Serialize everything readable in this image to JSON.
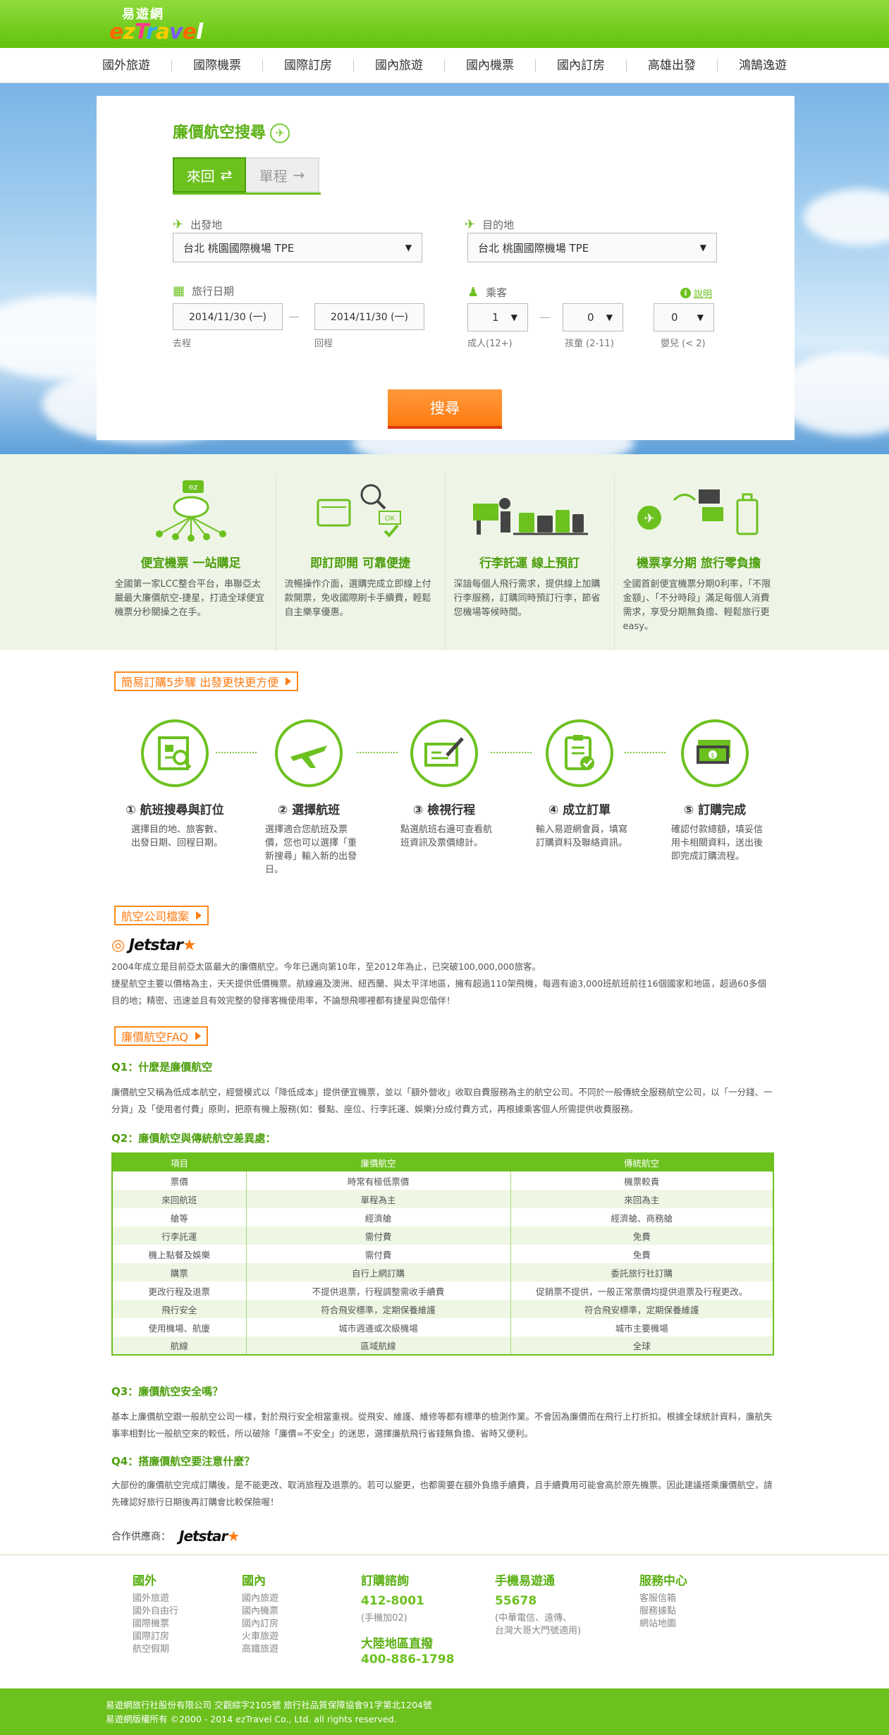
{
  "header": {
    "logo_cn": "易遊網",
    "logo_en": [
      "e",
      "z",
      "T",
      "r",
      "a",
      "v",
      "e",
      "l"
    ],
    "nav": [
      "國外旅遊",
      "國際機票",
      "國際訂房",
      "國內旅遊",
      "國內機票",
      "國內訂房",
      "高雄出發",
      "鴻鵠逸遊"
    ]
  },
  "search": {
    "title": "廉價航空搜尋",
    "tab_roundtrip": "來回",
    "tab_oneway": "單程",
    "depart_label": "出發地",
    "depart_value": "台北  桃園國際機場  TPE",
    "dest_label": "目的地",
    "dest_value": "台北  桃園國際機場  TPE",
    "date_label": "旅行日期",
    "date_go": "2014/11/30 (一)",
    "date_go_label": "去程",
    "date_back": "2014/11/30 (一)",
    "date_back_label": "回程",
    "pax_label": "乘客",
    "info_label": "說明",
    "adult_value": "1",
    "adult_label": "成人(12+)",
    "child_value": "0",
    "child_label": "孩童 (2-11)",
    "infant_value": "0",
    "infant_label": "嬰兒 (< 2)",
    "button": "搜尋"
  },
  "features": [
    {
      "title": "便宜機票  一站購足",
      "text": "全國第一家LCC整合平台，串聯亞太嚴最大廉價航空-捷星，打造全球便宜機票分秒關操之在手。"
    },
    {
      "title": "即訂即開  可靠便捷",
      "text": "流暢操作介面，選購完成立即線上付款開票，免收國際刷卡手續費，輕鬆自主樂享優惠。"
    },
    {
      "title": "行李託運  線上預訂",
      "text": "深諳每個人飛行需求，提供線上加購行李服務，訂購同時預訂行李，節省您機場等候時間。"
    },
    {
      "title": "機票享分期  旅行零負擔",
      "text": "全國首創便宜機票分期0利率，「不限金額」、「不分時段」滿足每個人消費需求，享受分期無負擔、輕鬆旅行更easy。"
    }
  ],
  "steps_header": "簡易訂購5步驟  出發更快更方便",
  "steps": [
    {
      "title": "① 航班搜尋與訂位",
      "text": "選擇目的地、旅客數、出發日期、回程日期。"
    },
    {
      "title": "② 選擇航班",
      "text": "選擇適合您航班及票價，您也可以選擇「重新搜尋」輸入新的出發日。"
    },
    {
      "title": "③ 檢視行程",
      "text": "點選航班右邊可查看航班資訊及票價總計。"
    },
    {
      "title": "④ 成立訂單",
      "text": "輸入易遊網會員，填寫訂購資料及聯絡資訊。"
    },
    {
      "title": "⑤ 訂購完成",
      "text": "確認付款總額，填妥信用卡相關資料，送出後即完成訂購流程。"
    }
  ],
  "airline": {
    "header": "航空公司檔案",
    "logo": "Jetstar",
    "text1": "2004年成立是目前亞太區最大的廉價航空。今年已邁向第10年，至2012年為止，已突破100,000,000旅客。",
    "text2": "捷星航空主要以價格為主，天天提供低價機票。航線遍及澳洲、紐西蘭、與太平洋地區，擁有超過110架飛機，每週有逾3,000班航班前往16個國家和地區，超過60多個目的地；精密、迅速並且有效完整的發揮客機使用率，不論想飛哪裡都有捷星與您偕伴！"
  },
  "faq": {
    "header": "廉價航空FAQ",
    "q1": "Q1：什麼是廉價航空",
    "a1": "廉價航空又稱為低成本航空，經營模式以「降低成本」提供便宜機票，並以「額外營收」收取自費服務為主的航空公司。不同於一般傳統全服務航空公司，以「一分錢、一分貨」及「使用者付費」原則，把原有機上服務(如：餐點、座位、行李託運、娛樂)分成付費方式，再根據乘客個人所需提供收費服務。",
    "q2": "Q2：廉價航空與傳統航空差異處：",
    "table_headers": [
      "項目",
      "廉價航空",
      "傳統航空"
    ],
    "table_rows": [
      [
        "票價",
        "時常有極低票價",
        "機票較貴"
      ],
      [
        "來回航班",
        "單程為主",
        "來回為主"
      ],
      [
        "艙等",
        "經濟艙",
        "經濟艙、商務艙"
      ],
      [
        "行李託運",
        "需付費",
        "免費"
      ],
      [
        "機上點餐及娛樂",
        "需付費",
        "免費"
      ],
      [
        "購票",
        "自行上網訂購",
        "委託旅行社訂購"
      ],
      [
        "更改行程及退票",
        "不提供退票，行程調整需收手續費",
        "促銷票不提供，一般正常票價均提供退票及行程更改。"
      ],
      [
        "飛行安全",
        "符合飛安標準，定期保養維護",
        "符合飛安標準，定期保養維護"
      ],
      [
        "使用機場、航廈",
        "城市週邊或次級機場",
        "城市主要機場"
      ],
      [
        "航線",
        "區域航線",
        "全球"
      ]
    ],
    "q3": "Q3：廉價航空安全嗎？",
    "a3": "基本上廉價航空跟一般航空公司一樣，對於飛行安全相當重視。從飛安、維護、維修等都有標準的檢測作業。不會因為廉價而在飛行上打折扣。根據全球統計資料，廉航失事率相對比一般航空來的較低，所以破除「廉價=不安全」的迷思，選擇廉航飛行省錢無負擔、省時又便利。",
    "q4": "Q4：搭廉價航空要注意什麼？",
    "a4": "大部份的廉價航空完成訂購後，是不能更改、取消旅程及退票的。若可以變更，也都需要在額外負擔手續費，且手續費用可能會高於原先機票。因此建議搭乘廉價航空，請先確認好旅行日期後再訂購會比較保險喔！"
  },
  "partner": {
    "label": "合作供應商：",
    "logo": "Jetstar"
  },
  "footer": {
    "col1_title": "國外",
    "col1_links": [
      "國外旅遊",
      "國外自由行",
      "國際機票",
      "國際訂房",
      "航空假期"
    ],
    "col2_title": "國內",
    "col2_links": [
      "國內旅遊",
      "國內機票",
      "國內訂房",
      "火車旅遊",
      "高鐵旅遊"
    ],
    "col3_title": "訂購諮詢",
    "col3_phone": "412-8001",
    "col3_note": "(手機加02)",
    "col3_title2": "大陸地區直撥",
    "col3_phone2": "400-886-1798",
    "col4_title": "手機易遊通",
    "col4_phone": "55678",
    "col4_note1": "(中華電信、遠傳、",
    "col4_note2": "台灣大哥大門號適用)",
    "col5_title": "服務中心",
    "col5_links": [
      "客服信箱",
      "服務據點",
      "網站地圖"
    ],
    "bottom1": "易遊網旅行社股份有限公司    交觀綜字2105號    旅行社品質保障協會91字第北1204號",
    "bottom2": "易遊網版權所有 ©2000 - 2014 ezTravel Co., Ltd. all rights reserved."
  },
  "colors": {
    "brand_green": "#6cc11f",
    "accent_orange": "#ff7a10"
  }
}
